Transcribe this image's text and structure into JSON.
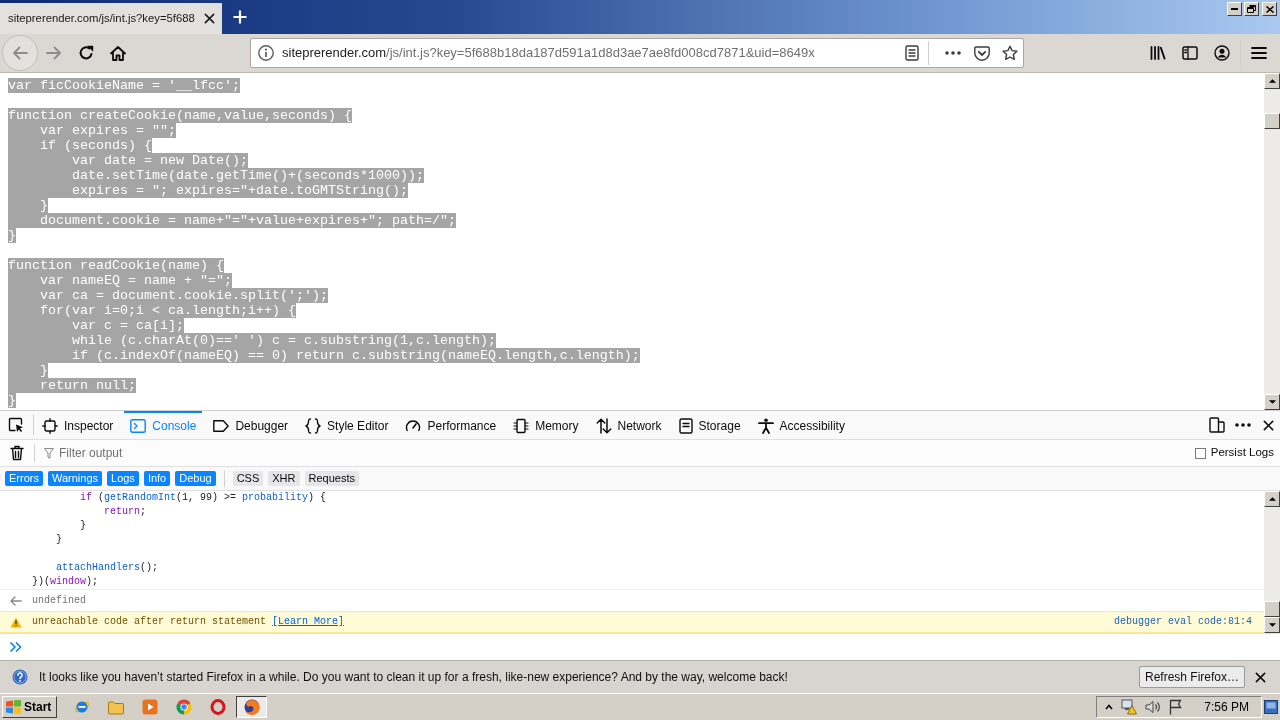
{
  "tabs": [
    {
      "title": "siteprerender.com/js/int.js?key=5f688",
      "selected": true
    }
  ],
  "nav_buttons": [
    {
      "kind": "back",
      "disabled": true
    },
    {
      "kind": "forward",
      "disabled": true
    },
    {
      "kind": "reload",
      "disabled": false
    },
    {
      "kind": "home",
      "disabled": false
    }
  ],
  "address_bar": {
    "host": "siteprerender.com",
    "path": "/js/int.js?key=5f688b18da187d591a1d8d3ae7ae8fd008cd7871&uid=8649x"
  },
  "page": {
    "selected": true,
    "blocks": [
      [
        "var ficCookieName = '__lfcc';"
      ],
      [
        "function createCookie(name,value,seconds) {",
        "    var expires = \"\";",
        "    if (seconds) {",
        "        var date = new Date();",
        "        date.setTime(date.getTime()+(seconds*1000));",
        "        expires = \"; expires=\"+date.toGMTString();",
        "    }",
        "    document.cookie = name+\"=\"+value+expires+\"; path=/\";",
        "}"
      ],
      [
        "function readCookie(name) {",
        "    var nameEQ = name + \"=\";",
        "    var ca = document.cookie.split(';');",
        "    for(var i=0;i < ca.length;i++) {",
        "        var c = ca[i];",
        "        while (c.charAt(0)==' ') c = c.substring(1,c.length);",
        "        if (c.indexOf(nameEQ) == 0) return c.substring(nameEQ.length,c.length);",
        "    }",
        "    return null;",
        "}"
      ]
    ]
  },
  "devtools": {
    "tabs": [
      {
        "kind": "inspector",
        "label": "Inspector",
        "selected": false
      },
      {
        "kind": "console",
        "label": "Console",
        "selected": true
      },
      {
        "kind": "debugger",
        "label": "Debugger",
        "selected": false
      },
      {
        "kind": "styleeditor",
        "label": "Style Editor",
        "selected": false
      },
      {
        "kind": "performance",
        "label": "Performance",
        "selected": false
      },
      {
        "kind": "memory",
        "label": "Memory",
        "selected": false
      },
      {
        "kind": "network",
        "label": "Network",
        "selected": false
      },
      {
        "kind": "storage",
        "label": "Storage",
        "selected": false
      },
      {
        "kind": "accessibility",
        "label": "Accessibility",
        "selected": false
      }
    ],
    "filter": {
      "placeholder": "Filter output"
    },
    "persist_logs": {
      "label": "Persist Logs",
      "checked": false
    },
    "level_filters": [
      {
        "label": "Errors",
        "selected": true
      },
      {
        "label": "Warnings",
        "selected": true
      },
      {
        "label": "Logs",
        "selected": true
      },
      {
        "label": "Info",
        "selected": true
      },
      {
        "label": "Debug",
        "selected": true
      }
    ],
    "type_filters": [
      {
        "label": "CSS",
        "selected": false
      },
      {
        "label": "XHR",
        "selected": false
      },
      {
        "label": "Requests",
        "selected": false
      }
    ],
    "messages": [
      {
        "kind": "code",
        "blocks": [
          [
            [
              {
                "kind": "keyword",
                "text": "        if"
              },
              {
                "kind": "plain",
                "text": " ("
              },
              {
                "kind": "name",
                "text": "getRandomInt"
              },
              {
                "kind": "plain",
                "text": "(1, 99) >= "
              },
              {
                "kind": "name",
                "text": "probability"
              },
              {
                "kind": "plain",
                "text": ") {"
              }
            ],
            [
              {
                "kind": "keyword",
                "text": "            return"
              },
              {
                "kind": "plain",
                "text": ";"
              }
            ],
            [
              {
                "kind": "plain",
                "text": "        }"
              }
            ],
            [
              {
                "kind": "plain",
                "text": "    }"
              }
            ]
          ],
          [
            [
              {
                "kind": "name",
                "text": "    attachHandlers"
              },
              {
                "kind": "plain",
                "text": "();"
              }
            ],
            [
              {
                "kind": "plain",
                "text": "})("
              },
              {
                "kind": "keyword",
                "text": "window"
              },
              {
                "kind": "plain",
                "text": ");"
              }
            ]
          ]
        ]
      },
      {
        "kind": "result",
        "text": "undefined"
      },
      {
        "kind": "warning",
        "text": "unreachable code after return statement",
        "link": "[Learn More]",
        "location": "debugger eval code:81:4"
      }
    ]
  },
  "notification": {
    "text": "It looks like you haven’t started Firefox in a while. Do you want to clean it up for a fresh, like-new experience? And by the way, welcome back!",
    "button": "Refresh Firefox…"
  },
  "taskbar": {
    "start": "Start",
    "apps": [
      {
        "kind": "ie",
        "selected": false
      },
      {
        "kind": "explorer",
        "selected": false
      },
      {
        "kind": "mediaplayer",
        "selected": false
      },
      {
        "kind": "chrome",
        "selected": false
      },
      {
        "kind": "opera",
        "selected": false
      },
      {
        "kind": "firefox",
        "selected": true
      }
    ],
    "clock": "7:56 PM"
  }
}
